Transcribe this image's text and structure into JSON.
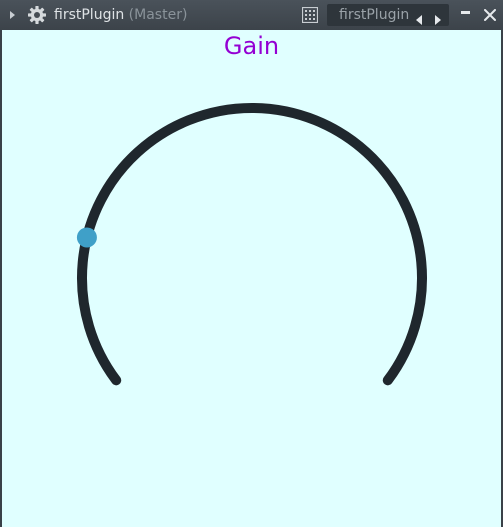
{
  "window": {
    "title": "firstPlugin",
    "subtitle": "(Master)",
    "preset_name": "firstPlugin"
  },
  "icons": {
    "menu": "triangle-right-icon",
    "settings": "gear-icon",
    "grid": "grid-icon",
    "prev": "triangle-left-icon",
    "next": "triangle-right-icon",
    "minimize": "minimize-icon",
    "close": "close-icon"
  },
  "knob": {
    "label": "Gain",
    "value": 0.2,
    "label_color": "#9400d3",
    "track_color": "#1f272d",
    "handle_color": "#3fa0c8",
    "background_color": "#e0ffff"
  }
}
